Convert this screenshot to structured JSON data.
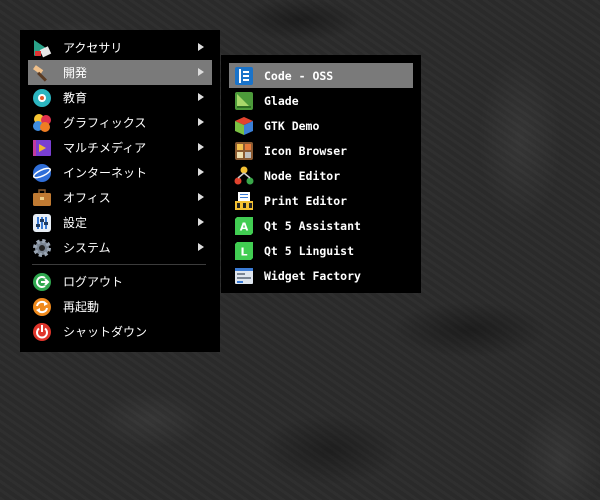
{
  "main_menu": {
    "items": [
      {
        "label": "アクセサリ"
      },
      {
        "label": "開発"
      },
      {
        "label": "教育"
      },
      {
        "label": "グラフィックス"
      },
      {
        "label": "マルチメディア"
      },
      {
        "label": "インターネット"
      },
      {
        "label": "オフィス"
      },
      {
        "label": "設定"
      },
      {
        "label": "システム"
      }
    ],
    "session_items": [
      {
        "label": "ログアウト"
      },
      {
        "label": "再起動"
      },
      {
        "label": "シャットダウン"
      }
    ],
    "selected": "開発"
  },
  "dev_submenu": {
    "items": [
      {
        "label": "Code - OSS"
      },
      {
        "label": "Glade"
      },
      {
        "label": "GTK Demo"
      },
      {
        "label": "Icon Browser"
      },
      {
        "label": "Node Editor"
      },
      {
        "label": "Print Editor"
      },
      {
        "label": "Qt 5 Assistant"
      },
      {
        "label": "Qt 5 Linguist"
      },
      {
        "label": "Widget Factory"
      }
    ],
    "highlighted": "Code - OSS"
  },
  "colors": {
    "menu_bg": "#000000",
    "highlight": "#7a7a7a",
    "text": "#ffffff"
  }
}
